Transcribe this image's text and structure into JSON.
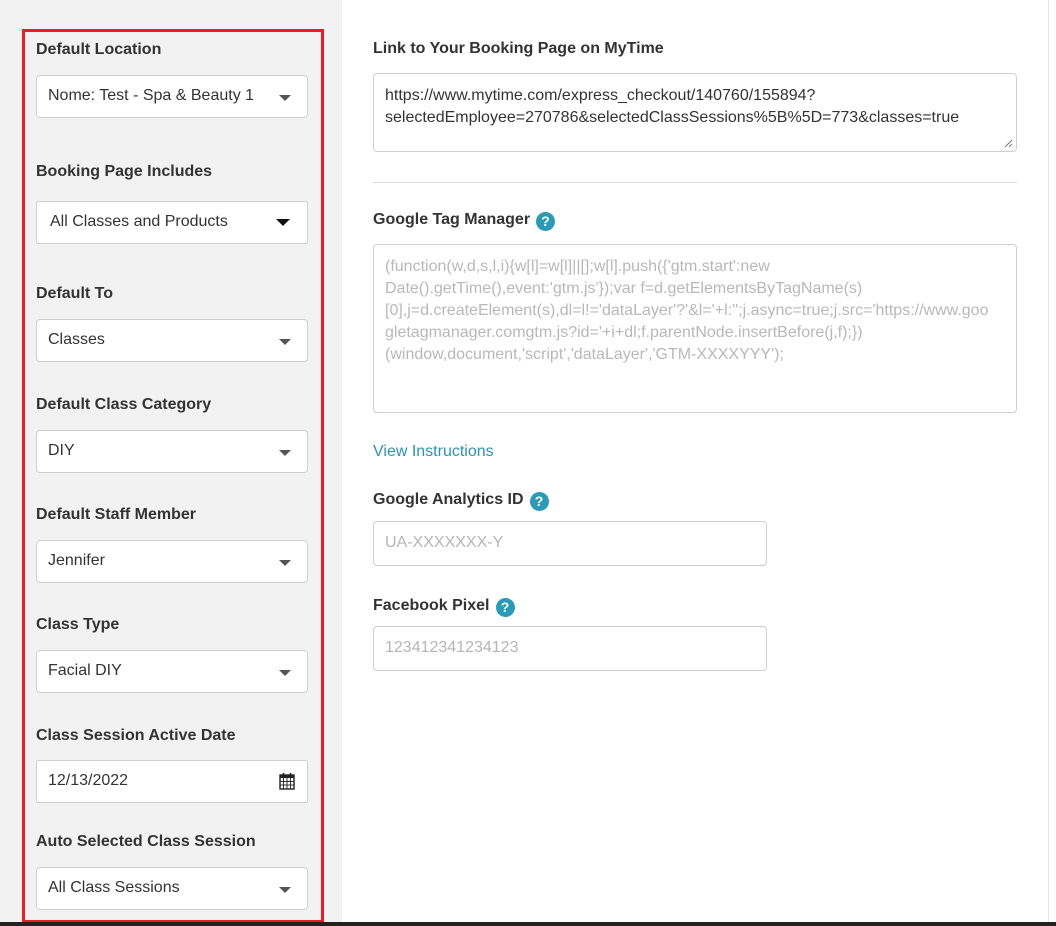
{
  "left_panel": {
    "default_location": {
      "label": "Default Location",
      "value": "Nome: Test - Spa & Beauty 1"
    },
    "booking_page_includes": {
      "label": "Booking Page Includes",
      "value": "All Classes and Products"
    },
    "default_to": {
      "label": "Default To",
      "value": "Classes"
    },
    "default_class_category": {
      "label": "Default Class Category",
      "value": "DIY"
    },
    "default_staff_member": {
      "label": "Default Staff Member",
      "value": "Jennifer"
    },
    "class_type": {
      "label": "Class Type",
      "value": "Facial DIY"
    },
    "class_session_active_date": {
      "label": "Class Session Active Date",
      "value": "12/13/2022"
    },
    "auto_selected_class_session": {
      "label": "Auto Selected Class Session",
      "value": "All Class Sessions"
    }
  },
  "right_panel": {
    "booking_link": {
      "label": "Link to Your Booking Page on MyTime",
      "value": "https://www.mytime.com/express_checkout/140760/155894?\nselectedEmployee=270786&selectedClassSessions%5B%5D=773&classes=true"
    },
    "google_tag_manager": {
      "label": "Google Tag Manager",
      "placeholder": "(function(w,d,s,l,i){w[l]=w[l]||[];w[l].push({'gtm.start':new\nDate().getTime(),event:'gtm.js'});var f=d.getElementsByTagName(s)\n[0],j=d.createElement(s),dl=l!='dataLayer'?'&l='+l:'';j.async=true;j.src='https://www.goo\ngletagmanager.comgtm.js?id='+i+dl;f.parentNode.insertBefore(j,f);})\n(window,document,'script','dataLayer','GTM-XXXXYYY');"
    },
    "view_instructions": "View Instructions",
    "google_analytics": {
      "label": "Google Analytics ID",
      "placeholder": "UA-XXXXXXX-Y"
    },
    "facebook_pixel": {
      "label": "Facebook Pixel",
      "placeholder": "123412341234123"
    }
  },
  "icons": {
    "help": "?"
  },
  "colors": {
    "highlight": "#ee1c25",
    "accent": "#2a9bb6",
    "link": "#2a93b0"
  }
}
